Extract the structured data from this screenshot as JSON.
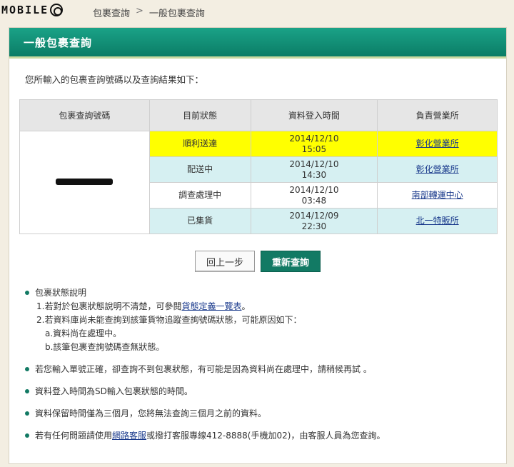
{
  "brand": {
    "logo_text": "MOBILE"
  },
  "breadcrumb": {
    "item1": "包裹查詢",
    "separator": ">",
    "item2": "一般包裹查詢"
  },
  "panel": {
    "title": "一般包裹查詢"
  },
  "intro": "您所輸入的包裹查詢號碼以及查詢結果如下：",
  "table": {
    "headers": [
      "包裹查詢號碼",
      "目前狀態",
      "資料登入時間",
      "負責營業所"
    ],
    "rows": [
      {
        "status": "順利送達",
        "date": "2014/12/10",
        "time": "15:05",
        "office": "彰化營業所",
        "highlight": "#ffff00"
      },
      {
        "status": "配送中",
        "date": "2014/12/10",
        "time": "14:30",
        "office": "彰化營業所",
        "highlight": "#d6f0f2"
      },
      {
        "status": "調查處理中",
        "date": "2014/12/10",
        "time": "03:48",
        "office": "南部轉運中心",
        "highlight": "#ffffff"
      },
      {
        "status": "已集貨",
        "date": "2014/12/09",
        "time": "22:30",
        "office": "北一特販所",
        "highlight": "#d6f0f2"
      }
    ]
  },
  "buttons": {
    "back": "回上一步",
    "requery": "重新查詢"
  },
  "notes": {
    "n1_title": "包裹狀態說明",
    "n1_line1_pre": "1.若對於包裹狀態說明不清楚，可參閱",
    "n1_line1_link": "貨態定義一覽表",
    "n1_line1_post": "。",
    "n1_line2": "2.若資料庫尚未能查詢到該筆貨物追蹤查詢號碼狀態，可能原因如下：",
    "n1_line2a": "a.資料尚在處理中。",
    "n1_line2b": "b.該筆包裹查詢號碼查無狀態。",
    "n2": "若您輸入單號正確，卻查詢不到包裹狀態，有可能是因為資料尚在處理中，請稍候再試 。",
    "n3": "資料登入時間為SD輸入包裹狀態的時間。",
    "n4": "資料保留時間僅為三個月，您將無法查詢三個月之前的資料。",
    "n5_pre": "若有任何問題請使用",
    "n5_link": "網路客服",
    "n5_post": "或撥打客服專線412-8888(手機加02)，由客服人員為您查詢。"
  },
  "colors": {
    "accent": "#127a64",
    "header_bg": "#1aa287",
    "link": "#1a3a8c"
  }
}
